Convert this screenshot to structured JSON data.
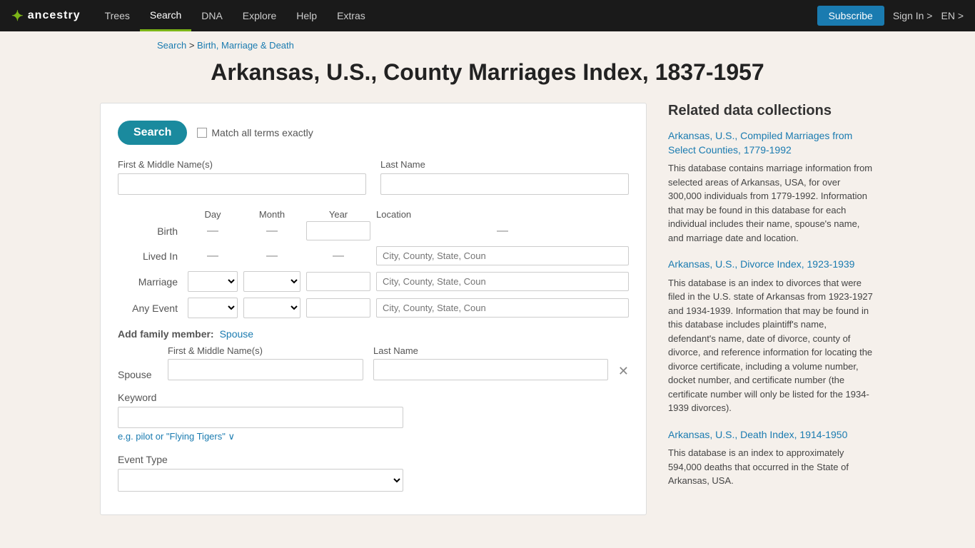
{
  "nav": {
    "logo_icon": "⚙",
    "logo_text": "ancestry",
    "links": [
      {
        "label": "Trees",
        "active": false
      },
      {
        "label": "Search",
        "active": true
      },
      {
        "label": "DNA",
        "active": false
      },
      {
        "label": "Explore",
        "active": false
      },
      {
        "label": "Help",
        "active": false
      },
      {
        "label": "Extras",
        "active": false
      }
    ],
    "subscribe_label": "Subscribe",
    "signin_label": "Sign In >",
    "lang_label": "EN >"
  },
  "breadcrumb": {
    "search_label": "Search",
    "separator": " > ",
    "section_label": "Birth, Marriage & Death"
  },
  "page_title": "Arkansas, U.S., County Marriages Index, 1837-1957",
  "search": {
    "button_label": "Search",
    "match_label": "Match all terms exactly",
    "first_name_label": "First & Middle Name(s)",
    "last_name_label": "Last Name",
    "col_day": "Day",
    "col_month": "Month",
    "col_year": "Year",
    "col_location": "Location",
    "birth_label": "Birth",
    "lived_in_label": "Lived In",
    "marriage_label": "Marriage",
    "any_event_label": "Any Event",
    "location_placeholder": "City, County, State, Coun",
    "family_member_label": "Add family member:",
    "spouse_link": "Spouse",
    "spouse_label": "Spouse",
    "spouse_first_label": "First & Middle Name(s)",
    "spouse_last_label": "Last Name",
    "keyword_label": "Keyword",
    "keyword_hint": "e.g. pilot or \"Flying Tigers\" ∨",
    "event_type_label": "Event Type"
  },
  "sidebar": {
    "title": "Related data collections",
    "items": [
      {
        "link_text": "Arkansas, U.S., Compiled Marriages from Select Counties, 1779-1992",
        "description": "This database contains marriage information from selected areas of Arkansas, USA, for over 300,000 individuals from 1779-1992. Information that may be found in this database for each individual includes their name, spouse's name, and marriage date and location."
      },
      {
        "link_text": "Arkansas, U.S., Divorce Index, 1923-1939",
        "description": "This database is an index to divorces that were filed in the U.S. state of Arkansas from 1923-1927 and 1934-1939. Information that may be found in this database includes plaintiff's name, defendant's name, date of divorce, county of divorce, and reference information for locating the divorce certificate, including a volume number, docket number, and certificate number (the certificate number will only be listed for the 1934-1939 divorces)."
      },
      {
        "link_text": "Arkansas, U.S., Death Index, 1914-1950",
        "description": "This database is an index to approximately 594,000 deaths that occurred in the State of Arkansas, USA."
      }
    ]
  }
}
